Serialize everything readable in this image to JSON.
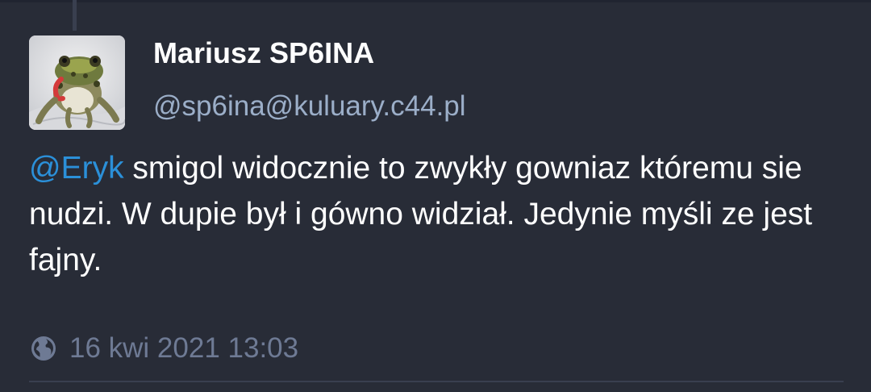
{
  "status": {
    "author": {
      "display_name": "Mariusz SP6INA",
      "account": "@sp6ina@kuluary.c44.pl",
      "avatar_icon": "frog-avatar"
    },
    "content": {
      "mention": "@Eryk",
      "text_after_mention": " smigol widocznie to zwykły gowniaz któremu sie nudzi. W dupie był i gówno widział. Jedynie myśli ze jest fajny."
    },
    "meta": {
      "visibility_icon": "globe-icon",
      "timestamp": "16 kwi 2021 13:03"
    }
  },
  "colors": {
    "background": "#282c37",
    "mention": "#2b90d9",
    "secondary_text": "#9baec8",
    "meta_text": "#6e7a94"
  }
}
